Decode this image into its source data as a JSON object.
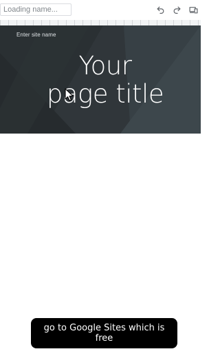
{
  "toolbar": {
    "name_input": {
      "value": "",
      "placeholder": "Loading name..."
    },
    "icons": {
      "undo": "undo-icon",
      "redo": "redo-icon",
      "preview": "preview-devices-icon"
    }
  },
  "banner": {
    "site_name": "Enter site name",
    "title_line1": "Your",
    "title_line2": "page title",
    "background_color": "#2f3538"
  },
  "caption": {
    "text": "go to Google Sites which is free"
  }
}
